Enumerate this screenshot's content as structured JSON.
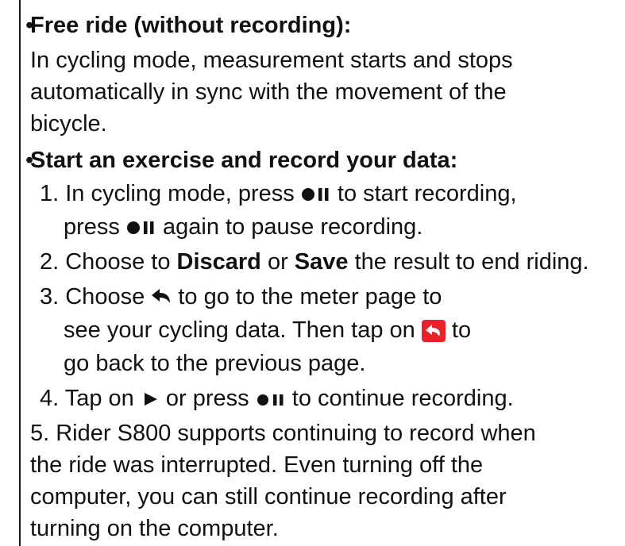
{
  "free_ride": {
    "bullet": "•",
    "title": "Free ride (without recording):",
    "body": [
      "In cycling mode, measurement starts and stops",
      "automatically in sync with the movement of the",
      "bicycle."
    ]
  },
  "record": {
    "bullet": "•",
    "title": "Start an exercise and record your data:",
    "step1": {
      "a": "1. In cycling mode, press ",
      "b": " to start recording,",
      "c": "press ",
      "d": " again to pause recording.",
      "icon": "record-pause-icon"
    },
    "step2": {
      "a": "2. Choose to ",
      "discard": "Discard",
      "b": " or ",
      "save": "Save",
      "c": " the result to end riding."
    },
    "step3": {
      "a": "3. Choose ",
      "b": " to go to the meter page to",
      "c": "see your cycling data. Then tap on ",
      "d": " to",
      "e": "go back to the previous page.",
      "icons": [
        "back-arrow-icon",
        "red-back-button-icon"
      ],
      "accent_color": "#e8212b"
    },
    "step4": {
      "a": "4. Tap on ",
      "b": " or press ",
      "c": " to continue recording.",
      "icons": [
        "play-icon",
        "record-pause-icon"
      ]
    },
    "step5": [
      "5. Rider S800 supports continuing to record when",
      "the ride was interrupted. Even turning off the",
      "computer, you can still continue recording after",
      "turning on the computer."
    ]
  }
}
